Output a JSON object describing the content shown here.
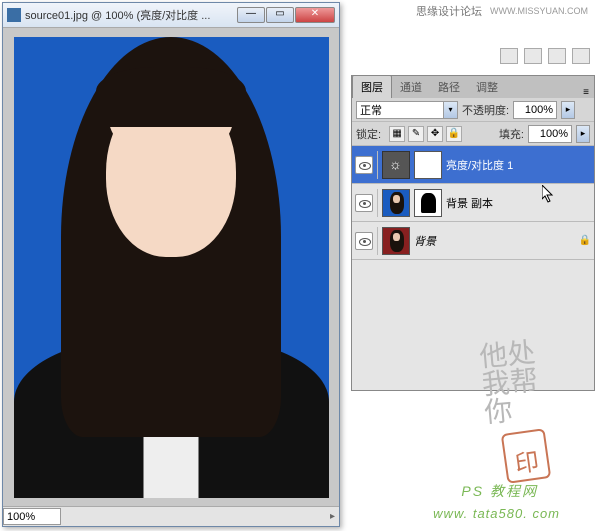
{
  "header": {
    "forum": "思缘设计论坛",
    "site": "WWW.MISSYUAN.COM"
  },
  "document": {
    "title": "source01.jpg @ 100% (亮度/对比度 ...",
    "zoom": "100%"
  },
  "panel": {
    "tabs": [
      "图层",
      "通道",
      "路径",
      "调整"
    ],
    "blend_label": "正常",
    "opacity_label": "不透明度:",
    "opacity_value": "100%",
    "lock_label": "锁定:",
    "fill_label": "填充:",
    "fill_value": "100%"
  },
  "layers": [
    {
      "name": "亮度/对比度 1",
      "type": "adjustment",
      "visible": true,
      "selected": true
    },
    {
      "name": "背景 副本",
      "type": "masked",
      "visible": true,
      "selected": false
    },
    {
      "name": "背景",
      "type": "background",
      "visible": true,
      "selected": false
    }
  ],
  "watermark": {
    "script": "他处我\n帮你",
    "label1": "PS 教程网",
    "label2": "www. tata580. com"
  }
}
